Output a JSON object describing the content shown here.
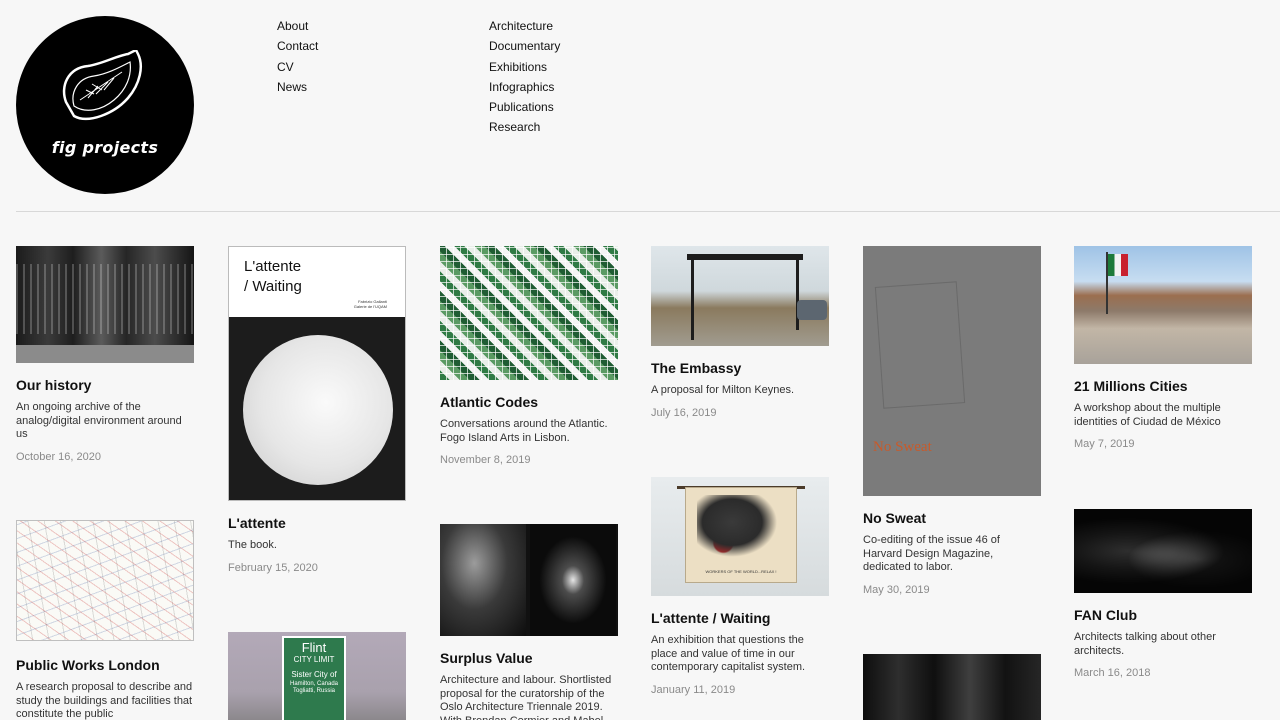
{
  "brand": {
    "name": "fig projects"
  },
  "nav_primary": [
    "About",
    "Contact",
    "CV",
    "News"
  ],
  "nav_categories": [
    "Architecture",
    "Documentary",
    "Exhibitions",
    "Infographics",
    "Publications",
    "Research"
  ],
  "cards": {
    "our_history": {
      "title": "Our history",
      "description": "An ongoing archive of the analog/digital environment around us",
      "date": "October 16, 2020"
    },
    "lattente_book": {
      "title": "L'attente",
      "description": "The book.",
      "date": "February 15, 2020",
      "cover_title": "L'attente\n/ Waiting",
      "cover_credits": "Fabrizio Gallanti\nGalerie de l'UQAM"
    },
    "atlantic_codes": {
      "title": "Atlantic Codes",
      "description": "Conversations around the Atlantic. Fogo Island Arts in Lisbon.",
      "date": "November 8, 2019"
    },
    "the_embassy": {
      "title": "The Embassy",
      "description": "A proposal for Milton Keynes.",
      "date": "July 16, 2019"
    },
    "no_sweat": {
      "title": "No Sweat",
      "description": "Co-editing of the issue 46 of Harvard Design Magazine, dedicated to labor.",
      "date": "May 30, 2019",
      "cover_text": "No Sweat"
    },
    "millions_cities": {
      "title": "21 Millions Cities",
      "description": "A workshop about the multiple identities of Ciudad de México",
      "date": "May 7, 2019"
    },
    "public_works": {
      "title": "Public Works London",
      "description": "A research proposal to describe and study the buildings and facilities that constitute the public"
    },
    "surplus_value": {
      "title": "Surplus Value",
      "description": "Architecture and labour. Shortlisted proposal for the curatorship of the Oslo Architecture Triennale 2019. With Brendan Cormier and Mabel"
    },
    "lattente_waiting": {
      "title": "L'attente / Waiting",
      "description": "An exhibition that questions the place and value of time in our contemporary capitalist system.",
      "date": "January 11, 2019",
      "banner_text": "WORKERS OF THE WORLD...RELAX !"
    },
    "fan_club": {
      "title": "FAN Club",
      "description": "Architects talking about other architects.",
      "date": "March 16, 2018"
    },
    "flint": {
      "sign_l1": "Flint",
      "sign_l2": "CITY LIMIT",
      "sign_l3": "Sister City of",
      "sign_l4": "Hamilton, Canada\nTogliatti, Russia"
    }
  },
  "colors": {
    "background": "#f7f7f7",
    "text": "#111111",
    "date": "#8a8a8a",
    "accent_orange": "#c85a2a"
  }
}
